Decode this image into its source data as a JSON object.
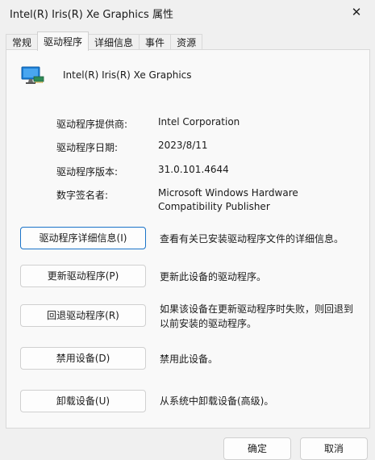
{
  "window": {
    "title": "Intel(R) Iris(R) Xe Graphics 属性",
    "close_glyph": "✕"
  },
  "tabs": [
    {
      "label": "常规"
    },
    {
      "label": "驱动程序",
      "active": true
    },
    {
      "label": "详细信息"
    },
    {
      "label": "事件"
    },
    {
      "label": "资源"
    }
  ],
  "device": {
    "name": "Intel(R) Iris(R) Xe Graphics",
    "icon": "display-adapter-icon"
  },
  "driver_info": {
    "provider_label": "驱动程序提供商:",
    "provider_value": "Intel Corporation",
    "date_label": "驱动程序日期:",
    "date_value": "2023/8/11",
    "version_label": "驱动程序版本:",
    "version_value": "31.0.101.4644",
    "signer_label": "数字签名者:",
    "signer_value_line1": "Microsoft Windows Hardware",
    "signer_value_line2": "Compatibility Publisher"
  },
  "actions": {
    "details_button": "驱动程序详细信息(I)",
    "details_desc": "查看有关已安装驱动程序文件的详细信息。",
    "update_button": "更新驱动程序(P)",
    "update_desc": "更新此设备的驱动程序。",
    "rollback_button": "回退驱动程序(R)",
    "rollback_desc_line1": "如果该设备在更新驱动程序时失败，则回退到",
    "rollback_desc_line2": "以前安装的驱动程序。",
    "disable_button": "禁用设备(D)",
    "disable_desc": "禁用此设备。",
    "uninstall_button": "卸载设备(U)",
    "uninstall_desc": "从系统中卸载设备(高级)。"
  },
  "footer": {
    "ok_label": "确定",
    "cancel_label": "取消"
  },
  "colors": {
    "focus_border": "#1a73c8",
    "window_bg": "#f0f0f0",
    "panel_bg": "#f9f9f9"
  }
}
